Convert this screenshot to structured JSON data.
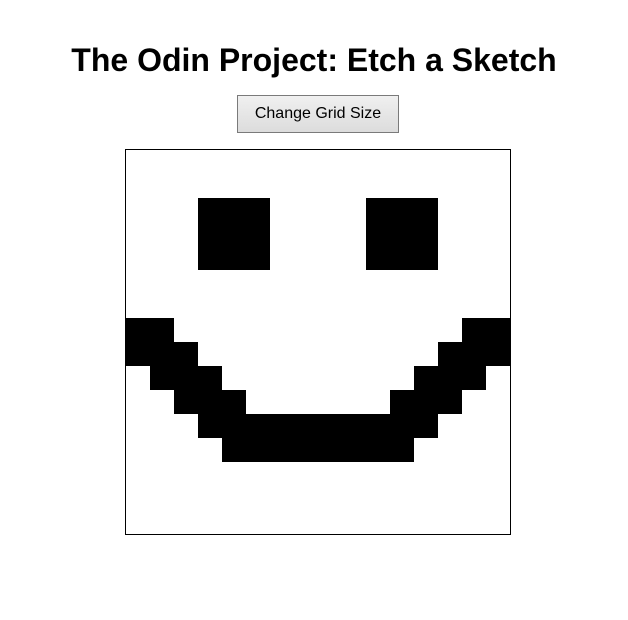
{
  "header": {
    "title": "The Odin Project: Etch a Sketch"
  },
  "controls": {
    "change_grid_label": "Change Grid Size"
  },
  "canvas": {
    "grid_size": 16,
    "ink_color": "#000000",
    "paper_color": "#ffffff",
    "filled_cells": [
      [
        2,
        3
      ],
      [
        2,
        4
      ],
      [
        2,
        5
      ],
      [
        2,
        10
      ],
      [
        2,
        11
      ],
      [
        2,
        12
      ],
      [
        3,
        3
      ],
      [
        3,
        4
      ],
      [
        3,
        5
      ],
      [
        3,
        10
      ],
      [
        3,
        11
      ],
      [
        3,
        12
      ],
      [
        4,
        3
      ],
      [
        4,
        4
      ],
      [
        4,
        5
      ],
      [
        4,
        10
      ],
      [
        4,
        11
      ],
      [
        4,
        12
      ],
      [
        7,
        0
      ],
      [
        7,
        1
      ],
      [
        7,
        14
      ],
      [
        7,
        15
      ],
      [
        8,
        0
      ],
      [
        8,
        1
      ],
      [
        8,
        2
      ],
      [
        8,
        13
      ],
      [
        8,
        14
      ],
      [
        8,
        15
      ],
      [
        9,
        1
      ],
      [
        9,
        2
      ],
      [
        9,
        3
      ],
      [
        9,
        12
      ],
      [
        9,
        13
      ],
      [
        9,
        14
      ],
      [
        10,
        2
      ],
      [
        10,
        3
      ],
      [
        10,
        4
      ],
      [
        10,
        11
      ],
      [
        10,
        12
      ],
      [
        10,
        13
      ],
      [
        11,
        3
      ],
      [
        11,
        4
      ],
      [
        11,
        5
      ],
      [
        11,
        6
      ],
      [
        11,
        7
      ],
      [
        11,
        8
      ],
      [
        11,
        9
      ],
      [
        11,
        10
      ],
      [
        11,
        11
      ],
      [
        11,
        12
      ],
      [
        12,
        4
      ],
      [
        12,
        5
      ],
      [
        12,
        6
      ],
      [
        12,
        7
      ],
      [
        12,
        8
      ],
      [
        12,
        9
      ],
      [
        12,
        10
      ],
      [
        12,
        11
      ]
    ]
  }
}
